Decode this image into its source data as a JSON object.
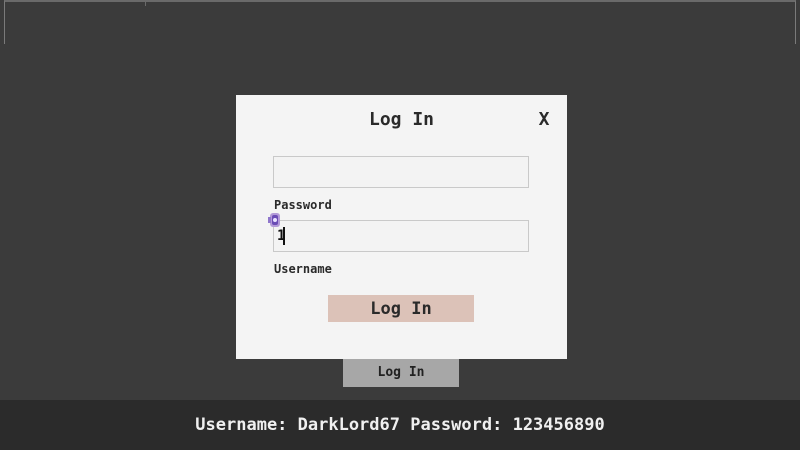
{
  "background": {
    "login_button_label": "Log In"
  },
  "dialog": {
    "title": "Log In",
    "close_label": "X",
    "first_field_value": "",
    "password_label": "Password",
    "second_field_value": "1",
    "username_label": "Username",
    "submit_label": "Log In"
  },
  "footer": {
    "credentials_text": "Username: DarkLord67 Password: 123456890"
  },
  "colors": {
    "background": "#3b3b3b",
    "dialog": "#f4f4f4",
    "submit_button": "#dcc2b8",
    "background_button": "#a7a7a7",
    "footer": "#2b2b2b"
  },
  "icons": {
    "cursor": "cursor-icon"
  }
}
